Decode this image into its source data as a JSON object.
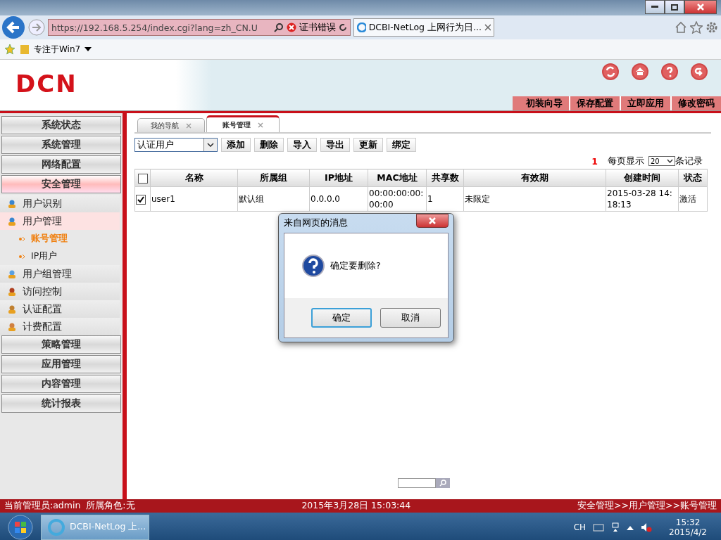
{
  "browser": {
    "url": "https://192.168.5.254/index.cgi?lang=zh_CN.U",
    "cert_error": "证书错误",
    "tab_title": "DCBI-NetLog 上网行为日...",
    "favorite": "专注于Win7"
  },
  "header": {
    "logo": "DCN",
    "actions": [
      "初装向导",
      "保存配置",
      "立即应用",
      "修改密码"
    ]
  },
  "sidebar": [
    {
      "label": "系统状态",
      "selected": false
    },
    {
      "label": "系统管理",
      "selected": false
    },
    {
      "label": "网络配置",
      "selected": false
    },
    {
      "label": "安全管理",
      "selected": true,
      "children": [
        {
          "label": "用户识别",
          "selected": false
        },
        {
          "label": "用户管理",
          "selected": true,
          "children": [
            {
              "label": "账号管理",
              "selected": true
            },
            {
              "label": "IP用户",
              "selected": false
            }
          ]
        },
        {
          "label": "用户组管理",
          "selected": false
        },
        {
          "label": "访问控制",
          "selected": false
        },
        {
          "label": "认证配置",
          "selected": false
        },
        {
          "label": "计费配置",
          "selected": false
        }
      ]
    },
    {
      "label": "策略管理",
      "selected": false
    },
    {
      "label": "应用管理",
      "selected": false
    },
    {
      "label": "内容管理",
      "selected": false
    },
    {
      "label": "统计报表",
      "selected": false
    }
  ],
  "content": {
    "tabs": [
      {
        "label": "我的导航",
        "selected": false
      },
      {
        "label": "账号管理",
        "selected": true
      }
    ],
    "filter": "认证用户",
    "buttons": [
      "添加",
      "删除",
      "导入",
      "导出",
      "更新",
      "绑定"
    ],
    "pager": {
      "page": "1",
      "label": "每页显示",
      "per_page": "20",
      "suffix": "条记录"
    },
    "table": {
      "header_checked": false,
      "columns": [
        "名称",
        "所属组",
        "IP地址",
        "MAC地址",
        "共享数",
        "有效期",
        "创建时间",
        "状态"
      ],
      "rows": [
        {
          "checked": true,
          "cells": [
            "user1",
            "默认组",
            "0.0.0.0",
            "00:00:00:00:00:00",
            "1",
            "未限定",
            "2015-03-28 14:18:13",
            "激活"
          ]
        }
      ]
    }
  },
  "dialog": {
    "title": "来自网页的消息",
    "message": "确定要删除?",
    "buttons": [
      {
        "label": "确定",
        "selected": true
      },
      {
        "label": "取消",
        "selected": false
      }
    ]
  },
  "status_bar": {
    "admin": "当前管理员:admin  所属角色:无",
    "time": "2015年3月28日 15:03:44",
    "breadcrumb": "安全管理>>用户管理>>账号管理"
  },
  "taskbar": {
    "task": "DCBI-NetLog 上...",
    "lang": "CH",
    "time": "15:32",
    "date": "2015/4/2"
  }
}
